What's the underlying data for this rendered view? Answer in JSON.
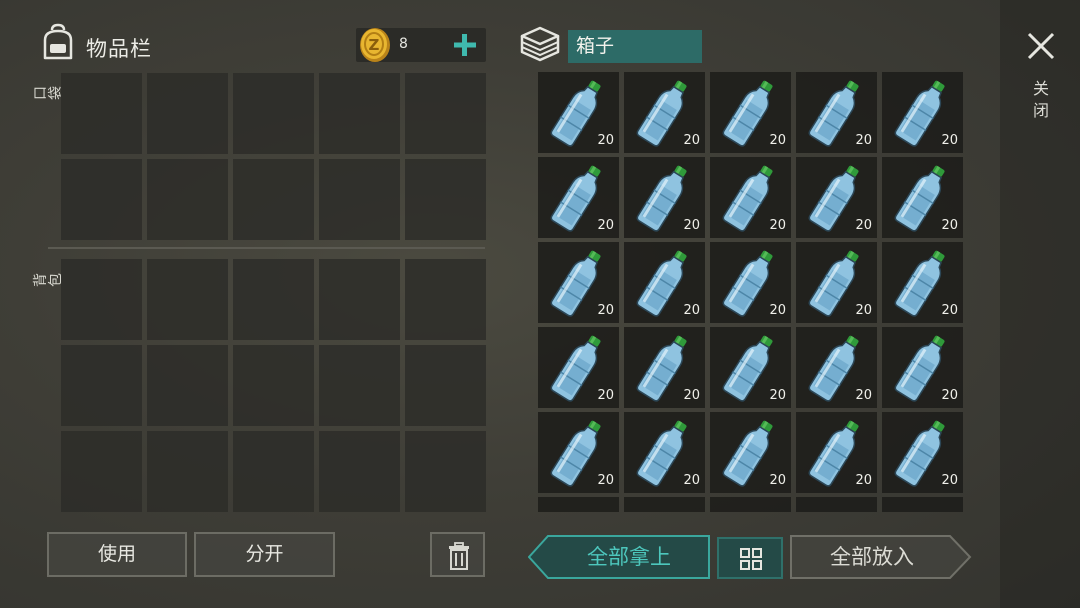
{
  "inventory": {
    "title": "物品栏",
    "coins": "8",
    "pocket_label": "口袋",
    "backpack_label": "背包",
    "pocket_slots": 10,
    "backpack_slots": 15
  },
  "box": {
    "title": "箱子",
    "items": [
      {
        "name": "water-bottle",
        "qty": "20"
      },
      {
        "name": "water-bottle",
        "qty": "20"
      },
      {
        "name": "water-bottle",
        "qty": "20"
      },
      {
        "name": "water-bottle",
        "qty": "20"
      },
      {
        "name": "water-bottle",
        "qty": "20"
      },
      {
        "name": "water-bottle",
        "qty": "20"
      },
      {
        "name": "water-bottle",
        "qty": "20"
      },
      {
        "name": "water-bottle",
        "qty": "20"
      },
      {
        "name": "water-bottle",
        "qty": "20"
      },
      {
        "name": "water-bottle",
        "qty": "20"
      },
      {
        "name": "water-bottle",
        "qty": "20"
      },
      {
        "name": "water-bottle",
        "qty": "20"
      },
      {
        "name": "water-bottle",
        "qty": "20"
      },
      {
        "name": "water-bottle",
        "qty": "20"
      },
      {
        "name": "water-bottle",
        "qty": "20"
      },
      {
        "name": "water-bottle",
        "qty": "20"
      },
      {
        "name": "water-bottle",
        "qty": "20"
      },
      {
        "name": "water-bottle",
        "qty": "20"
      },
      {
        "name": "water-bottle",
        "qty": "20"
      },
      {
        "name": "water-bottle",
        "qty": "20"
      },
      {
        "name": "water-bottle",
        "qty": "20"
      },
      {
        "name": "water-bottle",
        "qty": "20"
      },
      {
        "name": "water-bottle",
        "qty": "20"
      },
      {
        "name": "water-bottle",
        "qty": "20"
      },
      {
        "name": "water-bottle",
        "qty": "20"
      }
    ],
    "partial_row_slots": 5
  },
  "buttons": {
    "use": "使用",
    "split": "分开",
    "take_all": "全部拿上",
    "put_all": "全部放入",
    "close": "关闭"
  },
  "icons": {
    "bag": "backpack-icon",
    "coin": "coin-icon",
    "add": "plus-icon",
    "box": "box-icon",
    "trash": "trash-icon",
    "sort": "grid-sort-icon",
    "close": "close-icon",
    "item": "water-bottle-icon"
  },
  "colors": {
    "accent_teal": "#4dc7bd",
    "title_bar": "#2d6b67",
    "coin_gold": "#d9a520",
    "bottle_cap": "#2f9a3a"
  }
}
